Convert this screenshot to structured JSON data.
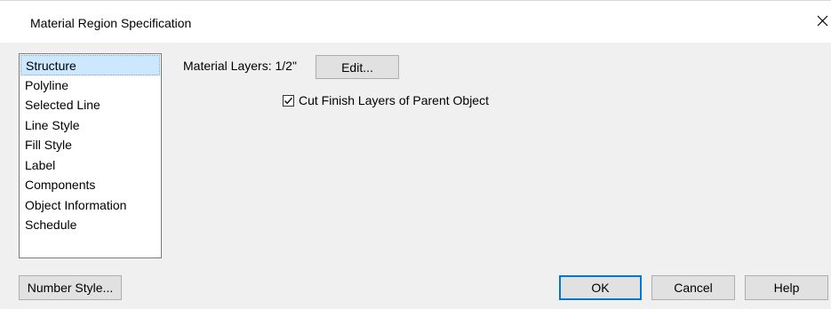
{
  "window": {
    "title": "Material Region Specification",
    "close_icon": "close-icon"
  },
  "sidebar": {
    "items": [
      {
        "label": "Structure",
        "selected": true
      },
      {
        "label": "Polyline",
        "selected": false
      },
      {
        "label": "Selected Line",
        "selected": false
      },
      {
        "label": "Line Style",
        "selected": false
      },
      {
        "label": "Fill Style",
        "selected": false
      },
      {
        "label": "Label",
        "selected": false
      },
      {
        "label": "Components",
        "selected": false
      },
      {
        "label": "Object Information",
        "selected": false
      },
      {
        "label": "Schedule",
        "selected": false
      }
    ]
  },
  "structure": {
    "material_layers_label": "Material Layers:",
    "material_layers_value": "1/2\"",
    "edit_button": "Edit...",
    "cut_finish_checkbox": {
      "label": "Cut Finish Layers of Parent Object",
      "checked": true
    }
  },
  "footer": {
    "number_style_button": "Number Style...",
    "ok_button": "OK",
    "cancel_button": "Cancel",
    "help_button": "Help"
  },
  "colors": {
    "dialog_background": "#f0f0f0",
    "selection_highlight": "#cce8ff",
    "default_button_border": "#0078d7",
    "button_face": "#e1e1e1"
  }
}
